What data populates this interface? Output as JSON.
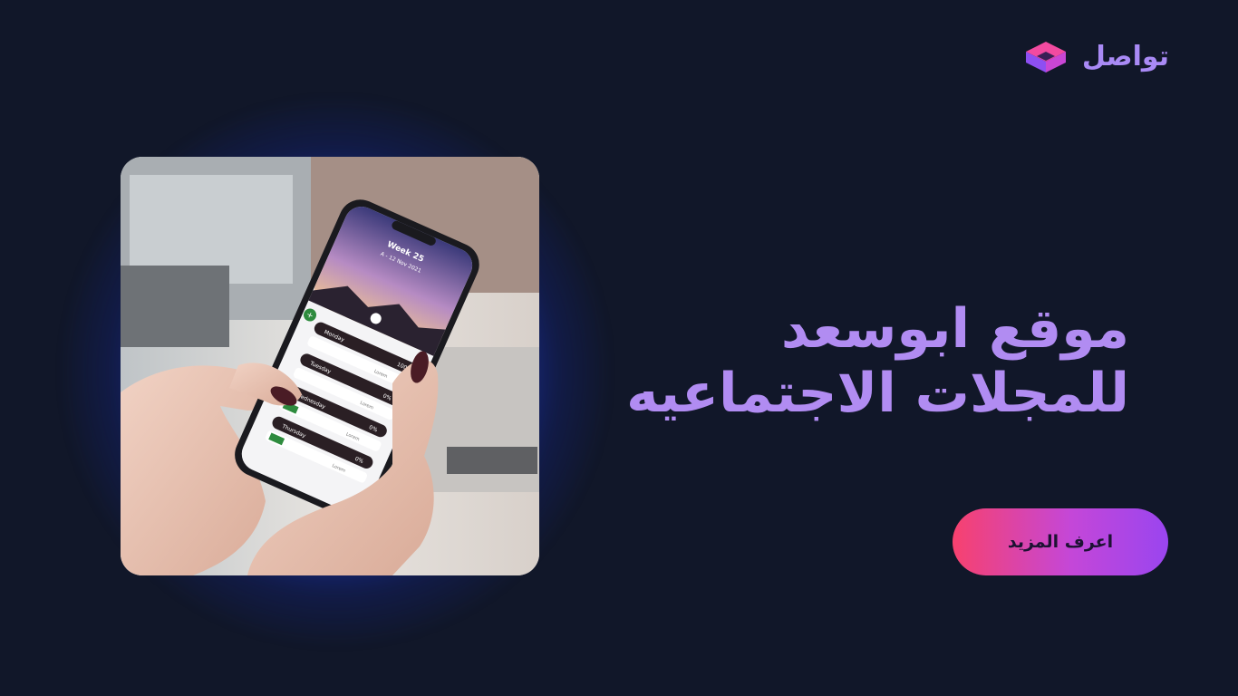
{
  "brand": {
    "name": "تواصل",
    "icon": "cube-logo-icon",
    "colors": {
      "top": "#f24aa0",
      "left": "#8d4ff2",
      "right": "#c946d4"
    }
  },
  "hero": {
    "title_line1": "موقع ابوسعد",
    "title_line2": "للمجلات الاجتماعيه",
    "cta_label": "اعرف المزيد"
  },
  "phone_screen": {
    "header_title": "Week 25",
    "header_subtitle": "A - 12 Nov 2021",
    "rows": [
      {
        "day": "Monday",
        "value": "100%",
        "status": "Lorem"
      },
      {
        "day": "Tuesday",
        "value": "0%",
        "status": "Lorem"
      },
      {
        "day": "Wednesday",
        "value": "0%",
        "status": "Lorem"
      },
      {
        "day": "Thursday",
        "value": "0%",
        "status": "Lorem"
      }
    ]
  },
  "colors": {
    "background": "#111729",
    "accent": "#b18cf2",
    "cta_start": "#f7416e",
    "cta_end": "#9a45ef",
    "glow": "#2850ff"
  }
}
